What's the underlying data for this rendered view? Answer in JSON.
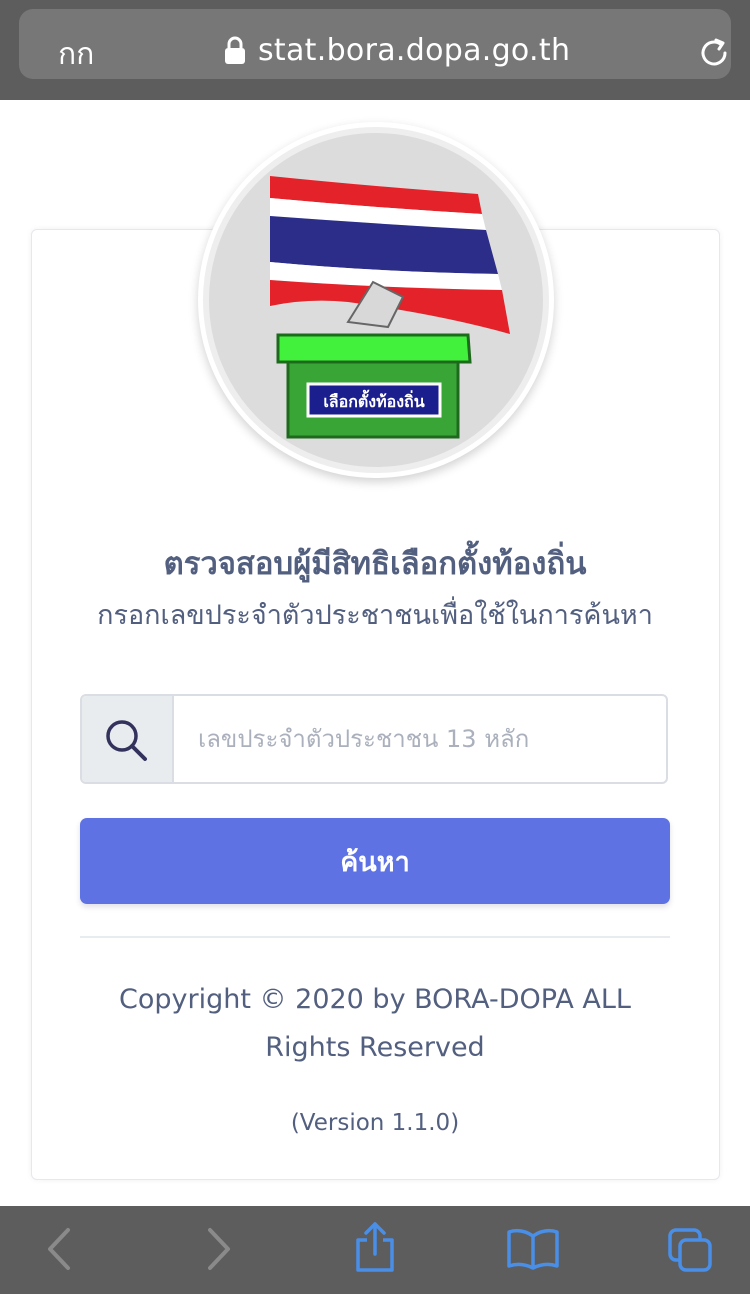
{
  "browser": {
    "text_size_label": "กก",
    "url": "stat.bora.dopa.go.th"
  },
  "logo": {
    "box_label": "เลือกตั้งท้องถิ่น"
  },
  "page": {
    "title": "ตรวจสอบผู้มีสิทธิเลือกตั้งท้องถิ่น",
    "subtitle": "กรอกเลขประจำตัวประชาชนเพื่อใช้ในการค้นหา"
  },
  "search": {
    "placeholder": "เลขประจำตัวประชาชน 13 หลัก",
    "value": "",
    "button_label": "ค้นหา"
  },
  "footer": {
    "copyright": "Copyright © 2020 by BORA-DOPA ALL Rights Reserved",
    "version": "(Version 1.1.0)"
  },
  "toolbar": {
    "icons": [
      "back-icon",
      "forward-icon",
      "share-icon",
      "bookmarks-icon",
      "tabs-icon"
    ]
  },
  "colors": {
    "accent": "#5e72e4",
    "text": "#525f7f",
    "chrome": "#5d5d5d"
  }
}
